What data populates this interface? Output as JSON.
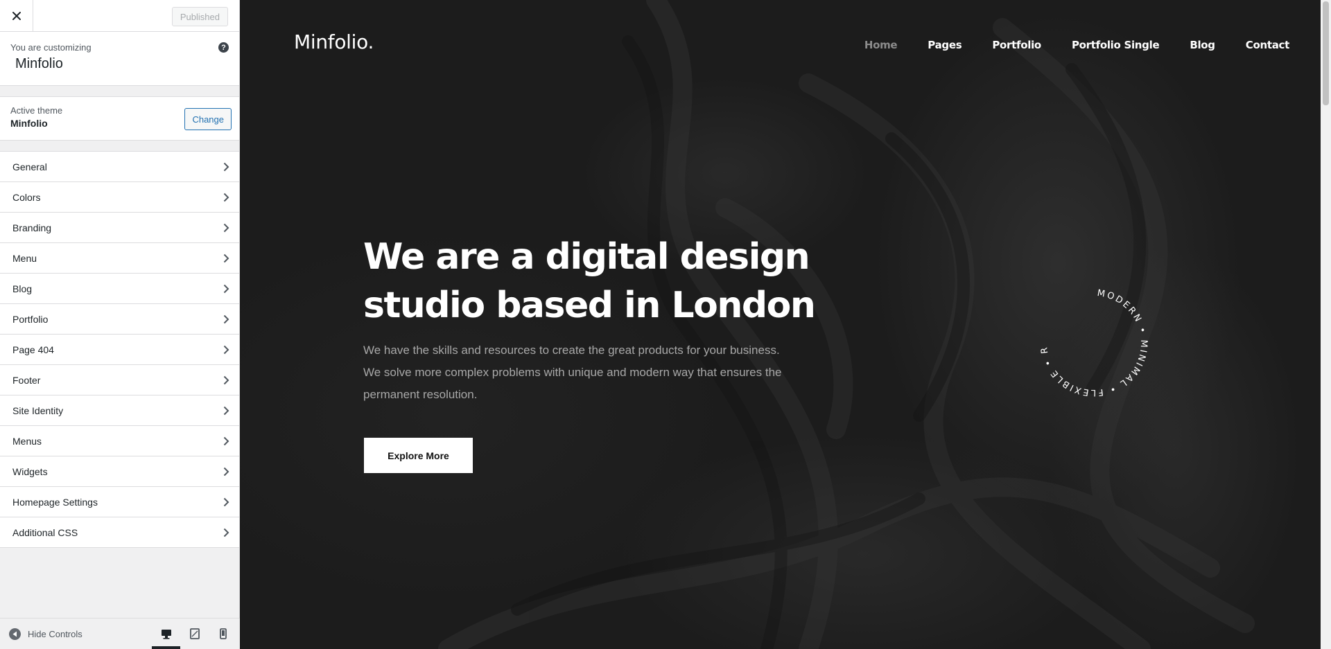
{
  "sidebar": {
    "publish_label": "Published",
    "customizing_label": "You are customizing",
    "site_title": "Minfolio",
    "help_symbol": "?",
    "active_theme_label": "Active theme",
    "active_theme_name": "Minfolio",
    "change_label": "Change",
    "sections": [
      {
        "label": "General"
      },
      {
        "label": "Colors"
      },
      {
        "label": "Branding"
      },
      {
        "label": "Menu"
      },
      {
        "label": "Blog"
      },
      {
        "label": "Portfolio"
      },
      {
        "label": "Page 404"
      },
      {
        "label": "Footer"
      },
      {
        "label": "Site Identity"
      },
      {
        "label": "Menus"
      },
      {
        "label": "Widgets"
      },
      {
        "label": "Homepage Settings"
      },
      {
        "label": "Additional CSS"
      }
    ],
    "hide_controls_label": "Hide Controls",
    "devices": [
      {
        "name": "desktop",
        "active": true
      },
      {
        "name": "tablet",
        "active": false
      },
      {
        "name": "mobile",
        "active": false
      }
    ]
  },
  "preview": {
    "logo": "Minfolio.",
    "nav": [
      {
        "label": "Home",
        "current": true
      },
      {
        "label": "Pages"
      },
      {
        "label": "Portfolio"
      },
      {
        "label": "Portfolio Single"
      },
      {
        "label": "Blog"
      },
      {
        "label": "Contact"
      }
    ],
    "hero_title_line1": "We are a digital design",
    "hero_title_line2": "studio based in London",
    "hero_text": "We have the skills and resources to create the great products for your business. We solve more complex problems with unique and modern way that ensures the permanent resolution.",
    "cta_label": "Explore More",
    "badge_text": "MODERN • MINIMAL • FLEXIBLE • RESPONSIVE • "
  },
  "colors": {
    "accent": "#2271b1",
    "sidebar_bg": "#f0f0f1",
    "preview_bg": "#1c1c1c",
    "nav_current": "#8c8c8c"
  }
}
